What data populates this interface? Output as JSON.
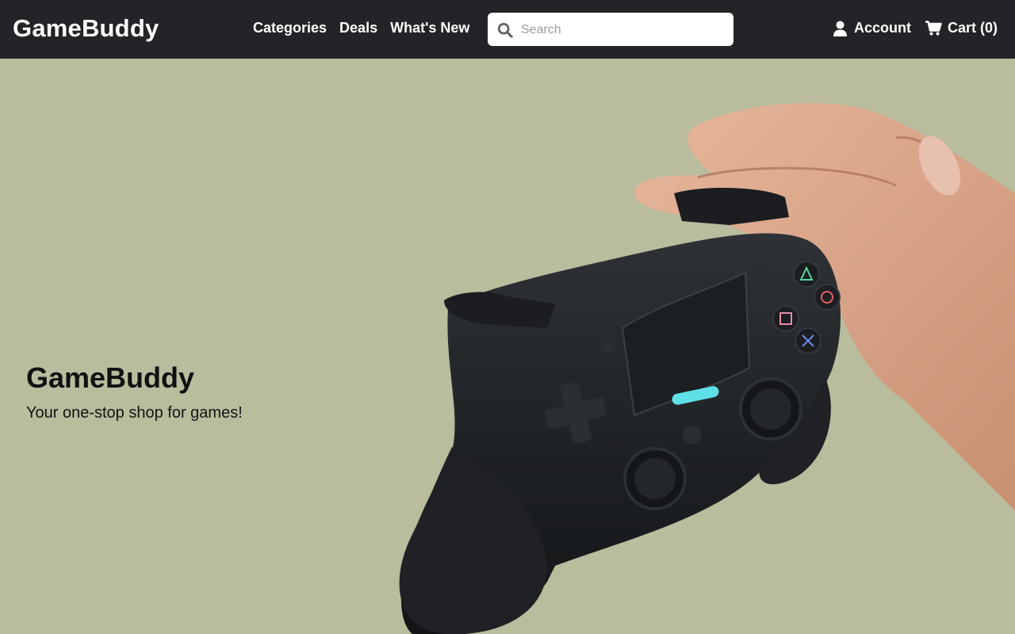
{
  "header": {
    "brand": "GameBuddy",
    "nav": [
      {
        "label": "Categories"
      },
      {
        "label": "Deals"
      },
      {
        "label": "What's New"
      }
    ],
    "search": {
      "placeholder": "Search",
      "value": "",
      "icon": "search-icon"
    },
    "account": {
      "label": "Account",
      "icon": "user-icon"
    },
    "cart": {
      "label": "Cart (0)",
      "icon": "cart-icon"
    }
  },
  "hero": {
    "title": "GameBuddy",
    "subtitle": "Your one-stop shop for games!",
    "image": "hand-holding-game-controller",
    "background_color": "#b9bc9d"
  },
  "colors": {
    "header_bg": "#232427",
    "header_text": "#ffffff",
    "accent_lightbar": "#5fe0e8"
  }
}
